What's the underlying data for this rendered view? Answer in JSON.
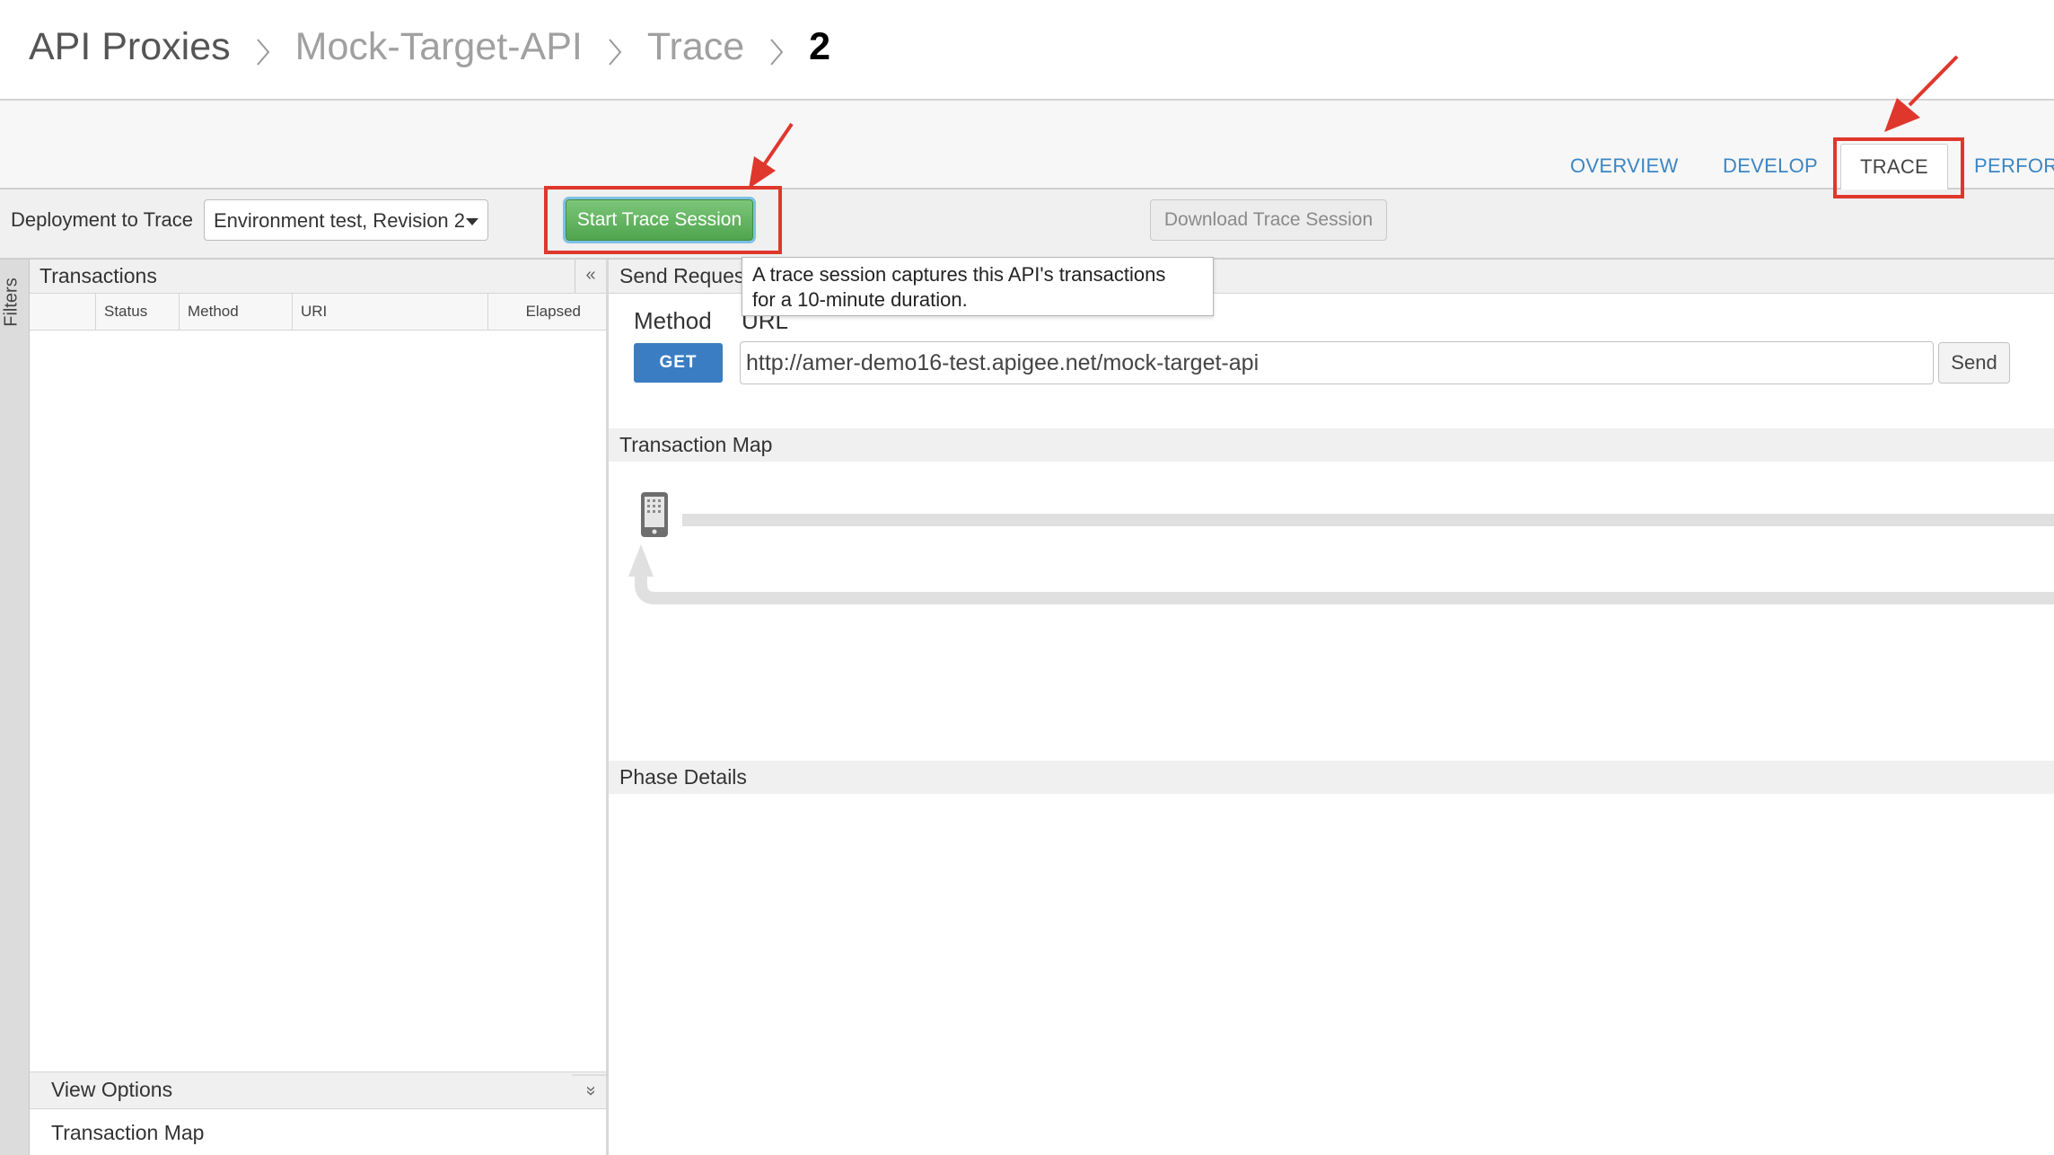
{
  "breadcrumb": {
    "items": [
      "API Proxies",
      "Mock-Target-API",
      "Trace",
      "2"
    ]
  },
  "tabs": [
    "OVERVIEW",
    "DEVELOP",
    "TRACE",
    "PERFORI"
  ],
  "active_tab": "TRACE",
  "toolbar": {
    "deployment_label": "Deployment to Trace",
    "deployment_value": "Environment test, Revision 2",
    "start_label": "Start Trace Session",
    "download_label": "Download Trace Session"
  },
  "tooltip": {
    "line1": "A trace session captures this API's transactions",
    "line2": "for a 10-minute duration."
  },
  "filters_label": "Filters",
  "transactions": {
    "title": "Transactions",
    "collapse_icon": "«",
    "columns": [
      "Status",
      "Method",
      "URI",
      "Elapsed"
    ]
  },
  "view_options": {
    "title": "View Options",
    "expand_icon": "»",
    "item": "Transaction Map"
  },
  "send_request": {
    "title": "Send Reques",
    "method_label": "Method",
    "url_label": "URL",
    "method": "GET",
    "url": "http://amer-demo16-test.apigee.net/mock-target-api",
    "send_label": "Send"
  },
  "sections": {
    "transaction_map": "Transaction Map",
    "phase_details": "Phase Details"
  },
  "colors": {
    "accent": "#3b86c4",
    "start_button": "#5bb55a",
    "annotation": "#e0372c",
    "get_button": "#3a7dc2"
  }
}
